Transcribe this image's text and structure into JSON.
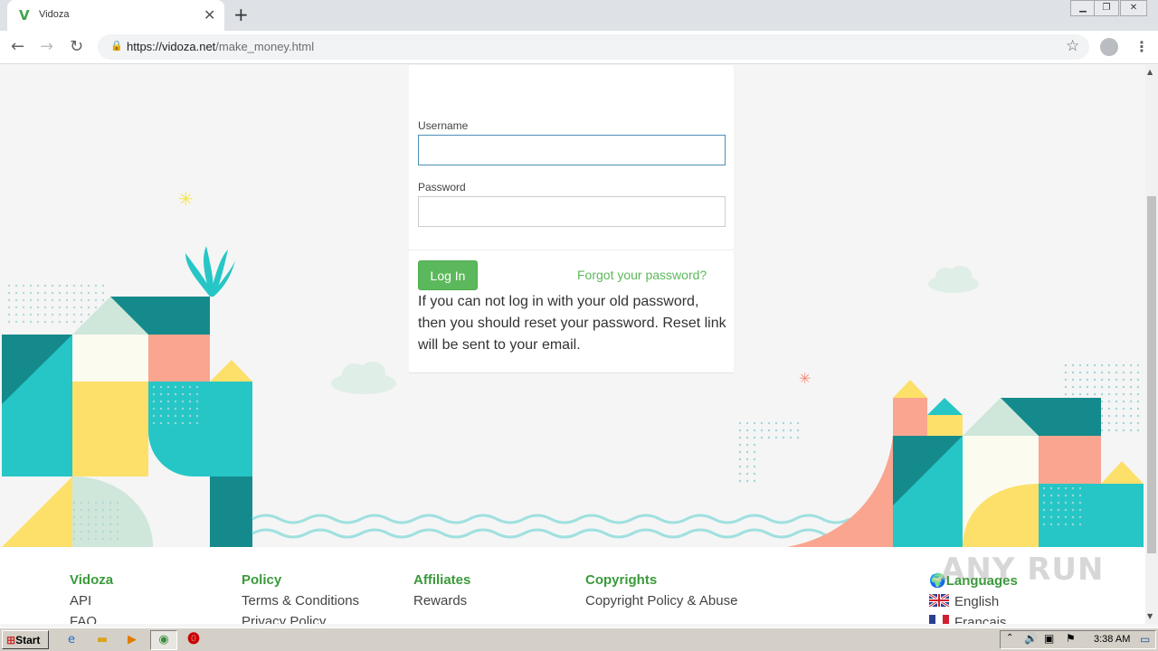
{
  "browser": {
    "tab_title": "Vidoza",
    "favicon_letter": "V",
    "url_host": "https://vidoza.net",
    "url_path": "/make_money.html"
  },
  "login": {
    "username_label": "Username",
    "username_value": "",
    "password_label": "Password",
    "password_value": "",
    "login_button": "Log In",
    "forgot_link": "Forgot your password?",
    "reset_note": "If you can not log in with your old password, then you should reset your password. Reset link will be sent to your email."
  },
  "footer": {
    "columns": [
      {
        "heading": "Vidoza",
        "links": [
          "API",
          "FAQ"
        ]
      },
      {
        "heading": "Policy",
        "links": [
          "Terms & Conditions",
          "Privacy Policy"
        ]
      },
      {
        "heading": "Affiliates",
        "links": [
          "Rewards"
        ]
      },
      {
        "heading": "Copyrights",
        "links": [
          "Copyright Policy & Abuse"
        ]
      },
      {
        "heading": "Languages",
        "links": [
          "English",
          "Français"
        ]
      }
    ]
  },
  "watermark": "ANY RUN",
  "taskbar": {
    "start_label": "Start",
    "clock": "3:38 AM"
  },
  "colors": {
    "accent_green": "#5cb85c",
    "teal": "#26c6c6",
    "dark_teal": "#148a8c",
    "salmon": "#f9a58f",
    "yellow": "#fde06a"
  }
}
